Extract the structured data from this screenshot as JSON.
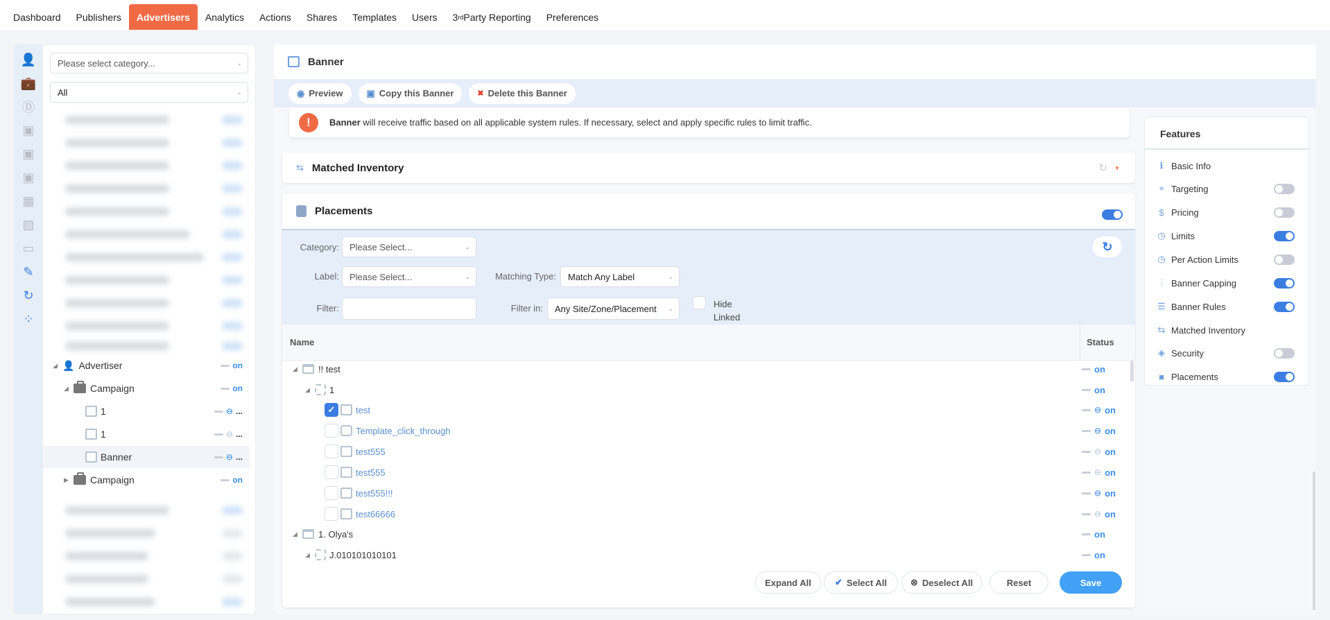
{
  "nav": {
    "tabs": [
      {
        "label": "Dashboard"
      },
      {
        "label": "Publishers"
      },
      {
        "label": "Advertisers",
        "active": true
      },
      {
        "label": "Analytics"
      },
      {
        "label": "Actions"
      },
      {
        "label": "Shares"
      },
      {
        "label": "Templates"
      },
      {
        "label": "Users"
      },
      {
        "label": "3",
        "sup": "rd",
        "rest": " Party Reporting"
      },
      {
        "label": "Preferences"
      }
    ]
  },
  "left": {
    "category_placeholder": "Please select category...",
    "status_filter": "All",
    "tree": [
      {
        "label": "Advertiser",
        "status": "on"
      },
      {
        "label": "Campaign",
        "status": "on"
      },
      {
        "label": "1",
        "status": "..."
      },
      {
        "label": "1",
        "status": "..."
      },
      {
        "label": "Banner",
        "status": "..."
      },
      {
        "label": "Campaign",
        "status": "on"
      }
    ]
  },
  "header": {
    "title": "Banner"
  },
  "toolbar": {
    "preview": "Preview",
    "copy": "Copy this Banner",
    "delete": "Delete this Banner"
  },
  "alert": {
    "bold": "Banner",
    "text": " will receive traffic based on all applicable system rules. If necessary, select and apply specific rules to limit traffic."
  },
  "matched_inventory": {
    "title": "Matched Inventory"
  },
  "placements": {
    "title": "Placements",
    "enabled": true,
    "filters": {
      "category_label": "Category:",
      "category_value": "Please Select...",
      "label_label": "Label:",
      "label_value": "Please Select...",
      "matching_label": "Matching Type:",
      "matching_value": "Match Any Label",
      "filter_label": "Filter:",
      "filter_value": "",
      "filter_in_label": "Filter in:",
      "filter_in_value": "Any Site/Zone/Placement",
      "hide_linked_1": "Hide",
      "hide_linked_2": "Linked"
    },
    "columns": {
      "name": "Name",
      "status": "Status"
    },
    "rows": [
      {
        "label": "!! test",
        "status": "on"
      },
      {
        "label": "1",
        "status": "on"
      },
      {
        "label": "test",
        "status": "on",
        "checked": true
      },
      {
        "label": "Template_click_through",
        "status": "on"
      },
      {
        "label": "test555",
        "status": "on"
      },
      {
        "label": "test555",
        "status": "on"
      },
      {
        "label": "test555!!!",
        "status": "on"
      },
      {
        "label": "test66666",
        "status": "on"
      },
      {
        "label": "1. Olya's",
        "status": "on"
      },
      {
        "label": "J.010101010101",
        "status": "on"
      }
    ],
    "buttons": {
      "expand": "Expand All",
      "select": "Select All",
      "deselect": "Deselect All",
      "reset": "Reset",
      "save": "Save"
    }
  },
  "features": {
    "title": "Features",
    "items": [
      {
        "label": "Basic Info"
      },
      {
        "label": "Targeting",
        "on": false
      },
      {
        "label": "Pricing",
        "on": false
      },
      {
        "label": "Limits",
        "on": true
      },
      {
        "label": "Per Action Limits",
        "on": false
      },
      {
        "label": "Banner Capping",
        "on": true
      },
      {
        "label": "Banner Rules",
        "on": true
      },
      {
        "label": "Matched Inventory"
      },
      {
        "label": "Security",
        "on": false
      },
      {
        "label": "Placements",
        "on": true
      }
    ]
  },
  "colors": {
    "accent": "#f06b45",
    "primary": "#3b7de0",
    "save": "#42a1f4"
  }
}
